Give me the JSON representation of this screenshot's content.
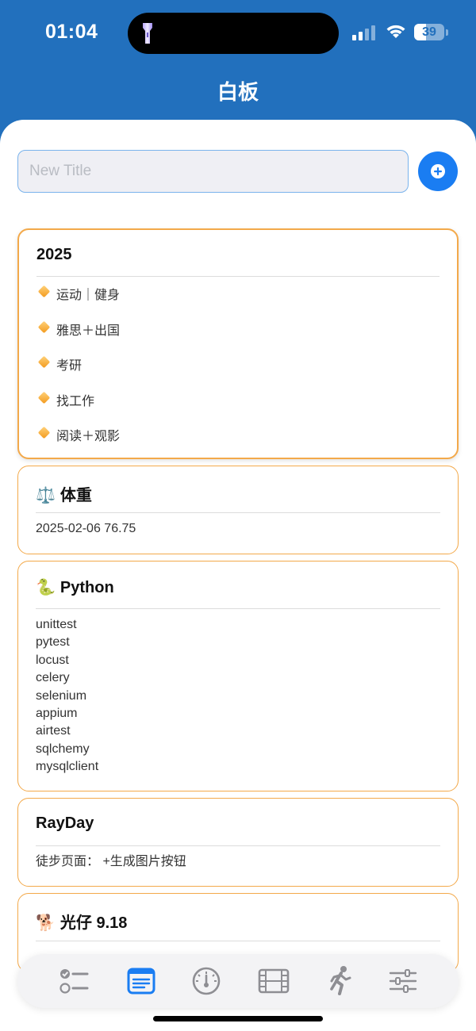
{
  "status_bar": {
    "time": "01:04",
    "battery_percent": "39",
    "battery_level": 0.39
  },
  "nav": {
    "title": "白板"
  },
  "new_title": {
    "placeholder": "New Title",
    "value": ""
  },
  "cards": {
    "goals": {
      "title": "2025",
      "items": [
        "运动｜健身",
        "雅思＋出国",
        "考研",
        "找工作",
        "阅读＋观影"
      ]
    },
    "weight": {
      "emoji": "⚖️",
      "title": "体重",
      "body": "2025-02-06 76.75"
    },
    "python": {
      "emoji": "🐍",
      "title": "Python",
      "lines": [
        "unittest",
        "pytest",
        "locust",
        "celery",
        "selenium",
        "appium",
        "airtest",
        "sqlchemy",
        "mysqlclient"
      ]
    },
    "rayday": {
      "title": "RayDay",
      "body": "徒步页面：  +生成图片按钮"
    },
    "dog": {
      "emoji": "🐕",
      "title": "光仔 9.18"
    }
  },
  "tab_bar": {
    "tabs": [
      {
        "icon": "checklist-icon",
        "selected": false
      },
      {
        "icon": "note-list-icon",
        "selected": true
      },
      {
        "icon": "gauge-icon",
        "selected": false
      },
      {
        "icon": "film-icon",
        "selected": false
      },
      {
        "icon": "running-figure-icon",
        "selected": false
      },
      {
        "icon": "sliders-icon",
        "selected": false
      }
    ]
  },
  "colors": {
    "header_blue": "#2270bd",
    "accent_blue": "#1a7df2",
    "card_border": "#f3a94a",
    "tab_inactive": "#8e8e93"
  }
}
